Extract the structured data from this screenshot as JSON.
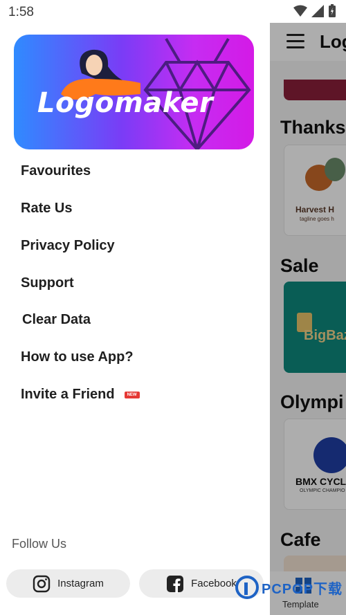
{
  "status_bar": {
    "time": "1:58"
  },
  "background_app": {
    "title": "Log",
    "sections": [
      {
        "title": "Thanks",
        "card_text": "Harvest H",
        "card_sub": "tagline goes h"
      },
      {
        "title": "Sale",
        "card_text": "BigBaz"
      },
      {
        "title": "Olympi",
        "card_text": "BMX CYCL",
        "card_sub": "OLYMPIC CHAMPIO"
      },
      {
        "title": "Cafe"
      }
    ],
    "bottom_tab_label": "Template"
  },
  "drawer": {
    "banner_title": "Logomaker",
    "menu": [
      {
        "label": "Favourites"
      },
      {
        "label": "Rate Us"
      },
      {
        "label": "Privacy Policy"
      },
      {
        "label": "Support"
      },
      {
        "label": "Clear Data"
      },
      {
        "label": "How to use App?"
      },
      {
        "label": "Invite a Friend",
        "badge": "NEW"
      }
    ],
    "follow_label": "Follow Us",
    "social": [
      {
        "label": "Instagram",
        "icon": "instagram-icon"
      },
      {
        "label": "Facebook",
        "icon": "facebook-icon"
      }
    ]
  },
  "watermark": "PCPOP下载",
  "colors": {
    "banner_start": "#2f8bff",
    "banner_end": "#d41ae6",
    "badge": "#e53935"
  }
}
